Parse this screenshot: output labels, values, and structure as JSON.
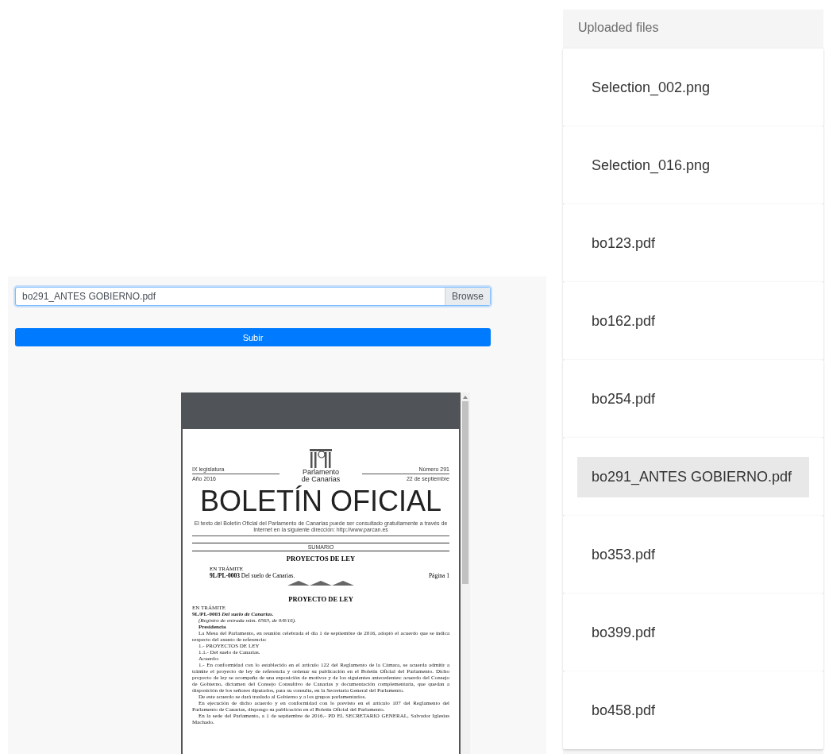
{
  "upload": {
    "file_field": {
      "value": "bo291_ANTES GOBIERNO.pdf"
    },
    "browse_button": "Browse",
    "submit_button": "Subir"
  },
  "pdf_viewer": {
    "document": {
      "header_left": [
        "IX legislatura",
        "Año 2016"
      ],
      "logo_text": [
        "Parlamento",
        "de Canarias"
      ],
      "header_right": [
        "Número 291",
        "22 de septiembre"
      ],
      "title": "BOLETÍN OFICIAL",
      "notice": "El texto del Boletín Oficial del Parlamento de Canarias puede ser consultado gratuitamente a través de Internet en la siguiente dirección: http://www.parcan.es",
      "section": "SUMARIO",
      "summary_heading": "PROYECTOS DE LEY",
      "summary": {
        "status": "EN TRÁMITE",
        "code": "9L/PL-0003",
        "title": "Del suelo de Canarias.",
        "page": "Página 1"
      },
      "body_heading": "PROYECTO DE LEY",
      "body": [
        {
          "kind": "status",
          "text": "EN TRÁMITE"
        },
        {
          "kind": "bold",
          "text": "9L/PL-0003 *Del suelo de Canarias.*"
        },
        {
          "kind": "italic",
          "text": "(Registro de entrada núm. 6563, de 9/8/16)."
        },
        {
          "kind": "heading",
          "text": "Presidencia"
        },
        {
          "kind": "para",
          "text": "La Mesa del Parlamento, en reunión celebrada el día 1 de septiembre de 2016, adoptó el acuerdo que se indica respecto del asunto de referencia:"
        },
        {
          "kind": "caps",
          "text": "1.- PROYECTOS DE LEY"
        },
        {
          "kind": "para",
          "text": "1.1.- Del suelo de Canarias."
        },
        {
          "kind": "para",
          "text": "Acuerdo:"
        },
        {
          "kind": "para",
          "text": "1.- En conformidad con lo establecido en el artículo 122 del Reglamento de la Cámara, se acuerda admitir a trámite el proyecto de ley de referencia y ordenar su publicación en el Boletín Oficial del Parlamento. Dicho proyecto de ley se acompaña de una exposición de motivos y de los siguientes antecedentes: acuerdo del Consejo de Gobierno, dictamen del Consejo Consultivo de Canarias y documentación complementaria, que quedan a disposición de los señores diputados, para su consulta, en la Secretaría General del Parlamento."
        },
        {
          "kind": "para",
          "text": "De este acuerdo se dará traslado al Gobierno y a los grupos parlamentarios."
        },
        {
          "kind": "para",
          "text": "En ejecución de dicho acuerdo y en conformidad con lo previsto en el artículo 107 del Reglamento del Parlamento de Canarias, dispongo su publicación en el Boletín Oficial del Parlamento."
        },
        {
          "kind": "para",
          "text": "En la sede del Parlamento, a 1 de septiembre de 2016.- PD EL SECRETARIO GENERAL, Salvador Iglesias Machado."
        }
      ]
    }
  },
  "uploaded_files": {
    "title": "Uploaded files",
    "items": [
      {
        "name": "Selection_002.png",
        "selected": false
      },
      {
        "name": "Selection_016.png",
        "selected": false
      },
      {
        "name": "bo123.pdf",
        "selected": false
      },
      {
        "name": "bo162.pdf",
        "selected": false
      },
      {
        "name": "bo254.pdf",
        "selected": false
      },
      {
        "name": "bo291_ANTES GOBIERNO.pdf",
        "selected": true
      },
      {
        "name": "bo353.pdf",
        "selected": false
      },
      {
        "name": "bo399.pdf",
        "selected": false
      },
      {
        "name": "bo458.pdf",
        "selected": false
      }
    ]
  }
}
